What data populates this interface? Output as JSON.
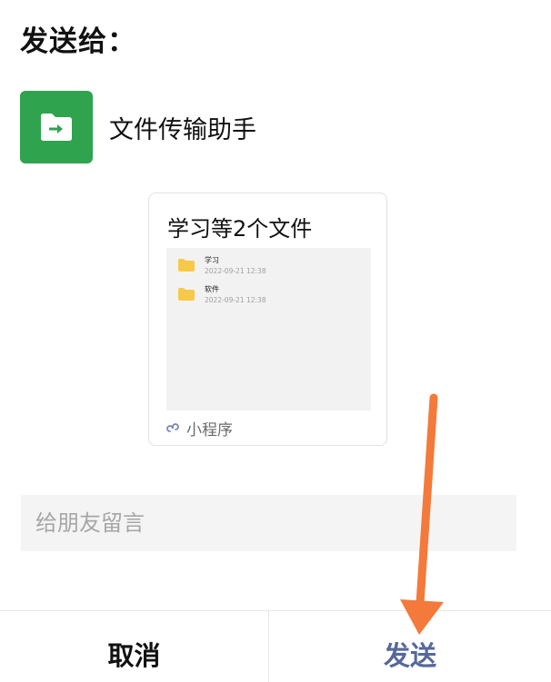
{
  "dialog": {
    "title": "发送给："
  },
  "recipient": {
    "name": "文件传输助手",
    "avatar_color": "#2fa34e",
    "icon": "folder-arrow-icon"
  },
  "share_card": {
    "title": "学习等2个文件",
    "files": [
      {
        "name": "学习",
        "date": "2022-09-21  12:38",
        "icon": "folder-icon"
      },
      {
        "name": "软件",
        "date": "2022-09-21  12:38",
        "icon": "folder-icon"
      }
    ],
    "source_label": "小程序",
    "source_icon": "mini-program-icon"
  },
  "message": {
    "placeholder": "给朋友留言",
    "value": ""
  },
  "actions": {
    "cancel_label": "取消",
    "send_label": "发送",
    "send_color": "#56689a"
  },
  "annotation": {
    "arrow_color": "#f37a3b",
    "icon": "pointer-arrow-icon"
  }
}
